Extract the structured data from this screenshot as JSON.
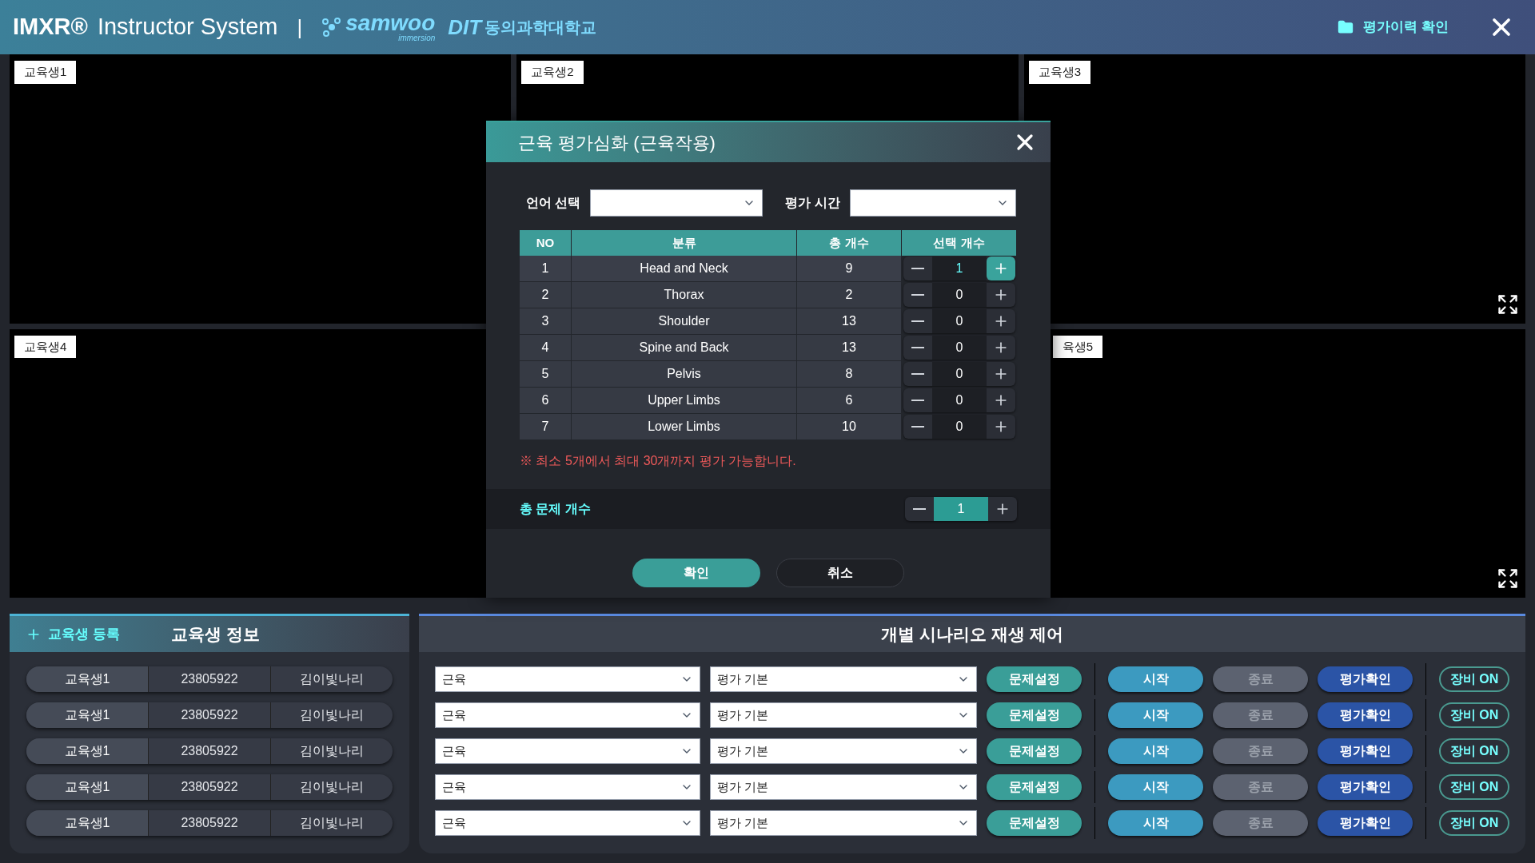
{
  "header": {
    "brand": "IMXR®",
    "title": "Instructor System",
    "separator": "|",
    "samwoo_logo": "samwoo",
    "samwoo_tagline": "immersion",
    "dit_logo": "DIT",
    "school_name": "동의과학대학교",
    "history_button": "평가이력 확인"
  },
  "video_panels": [
    {
      "label": "교육생1"
    },
    {
      "label": "교육생2"
    },
    {
      "label": "교육생3",
      "expand_icon": true
    },
    {
      "label": "교육생4"
    },
    {
      "label": "육생5",
      "expand_icon": true
    }
  ],
  "dialog": {
    "title": "근육 평가심화 (근육작용)",
    "language_label": "언어 선택",
    "time_label": "평가 시간",
    "columns": [
      "NO",
      "분류",
      "총 개수",
      "선택 개수"
    ],
    "rows": [
      {
        "no": "1",
        "category": "Head and Neck",
        "total": "9",
        "count": "1",
        "selected": true
      },
      {
        "no": "2",
        "category": "Thorax",
        "total": "2",
        "count": "0",
        "selected": false
      },
      {
        "no": "3",
        "category": "Shoulder",
        "total": "13",
        "count": "0",
        "selected": false
      },
      {
        "no": "4",
        "category": "Spine and Back",
        "total": "13",
        "count": "0",
        "selected": false
      },
      {
        "no": "5",
        "category": "Pelvis",
        "total": "8",
        "count": "0",
        "selected": false
      },
      {
        "no": "6",
        "category": "Upper Limbs",
        "total": "6",
        "count": "0",
        "selected": false
      },
      {
        "no": "7",
        "category": "Lower Limbs",
        "total": "10",
        "count": "0",
        "selected": false
      }
    ],
    "notice": "※ 최소 5개에서 최대 30개까지 평가 가능합니다.",
    "total_label": "총 문제 개수",
    "total_value": "1",
    "confirm": "확인",
    "cancel": "취소"
  },
  "student_panel": {
    "register_button": "교육생 등록",
    "title": "교육생 정보",
    "students": [
      {
        "name": "교육생1",
        "id": "23805922",
        "person": "김이빛나리"
      },
      {
        "name": "교육생1",
        "id": "23805922",
        "person": "김이빛나리"
      },
      {
        "name": "교육생1",
        "id": "23805922",
        "person": "김이빛나리"
      },
      {
        "name": "교육생1",
        "id": "23805922",
        "person": "김이빛나리"
      },
      {
        "name": "교육생1",
        "id": "23805922",
        "person": "김이빛나리"
      }
    ]
  },
  "control_panel": {
    "title": "개별 시나리오 재생 제어",
    "rows": [
      {
        "scenario": "근육",
        "mode": "평가 기본",
        "setup": "문제설정",
        "start": "시작",
        "stop": "종료",
        "stop_disabled": true,
        "check": "평가확인",
        "device": "장비 ON"
      },
      {
        "scenario": "근육",
        "mode": "평가 기본",
        "setup": "문제설정",
        "start": "시작",
        "stop": "종료",
        "stop_disabled": true,
        "check": "평가확인",
        "device": "장비 ON"
      },
      {
        "scenario": "근육",
        "mode": "평가 기본",
        "setup": "문제설정",
        "start": "시작",
        "stop": "종료",
        "stop_disabled": true,
        "check": "평가확인",
        "device": "장비 ON"
      },
      {
        "scenario": "근육",
        "mode": "평가 기본",
        "setup": "문제설정",
        "start": "시작",
        "stop": "종료",
        "stop_disabled": true,
        "check": "평가확인",
        "device": "장비 ON"
      },
      {
        "scenario": "근육",
        "mode": "평가 기본",
        "setup": "문제설정",
        "start": "시작",
        "stop": "종료",
        "stop_disabled": true,
        "check": "평가확인",
        "device": "장비 ON"
      }
    ]
  }
}
